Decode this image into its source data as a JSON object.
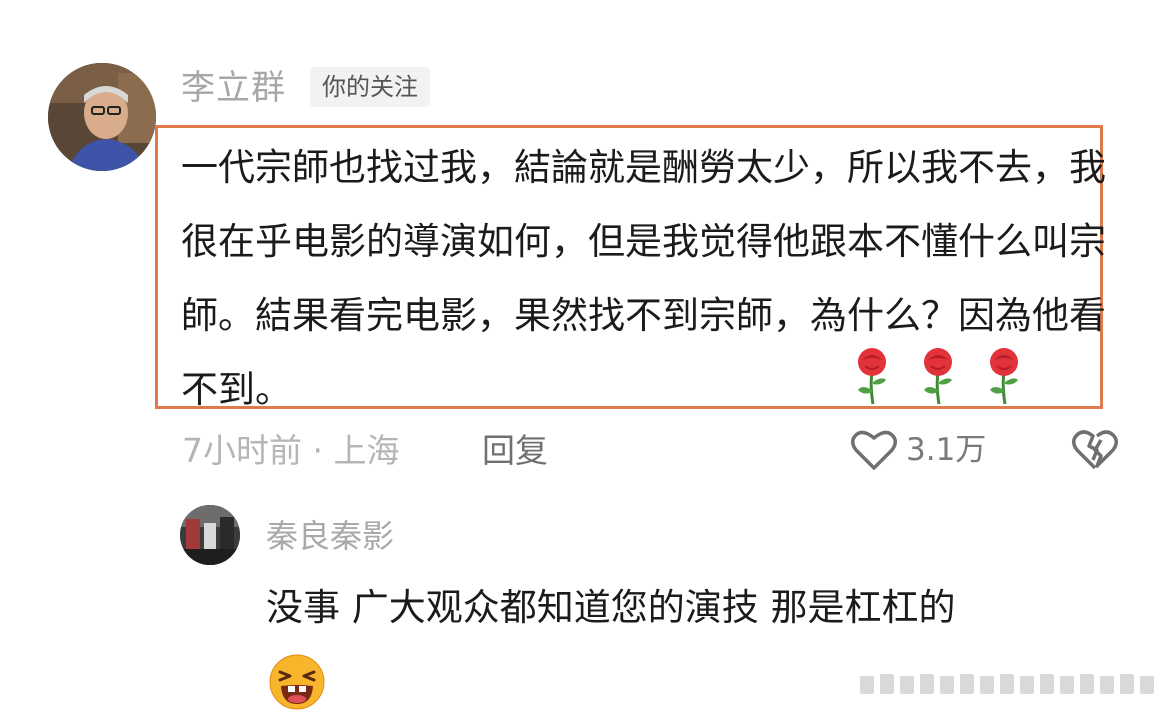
{
  "comment": {
    "author": "李立群",
    "badge": "你的关注",
    "text": "一代宗師也找过我，結論就是酬勞太少，所以我不去，我很在乎电影的導演如何，但是我觉得他跟本不懂什么叫宗師。結果看完电影，果然找不到宗師，為什么？因為他看不到。",
    "emoji": [
      "rose-icon",
      "rose-icon",
      "rose-icon"
    ],
    "meta": "7小时前 · 上海",
    "reply_label": "回复",
    "like_count": "3.1万"
  },
  "reply": {
    "author": "秦良秦影",
    "text": "没事 广大观众都知道您的演技 那是杠杠的",
    "emoji": "laughing-face-icon"
  },
  "colors": {
    "highlight_border": "#df7a4a",
    "text_primary": "#1b1b1b",
    "text_secondary": "#a7a7a7",
    "badge_bg": "#f2f2f2"
  }
}
